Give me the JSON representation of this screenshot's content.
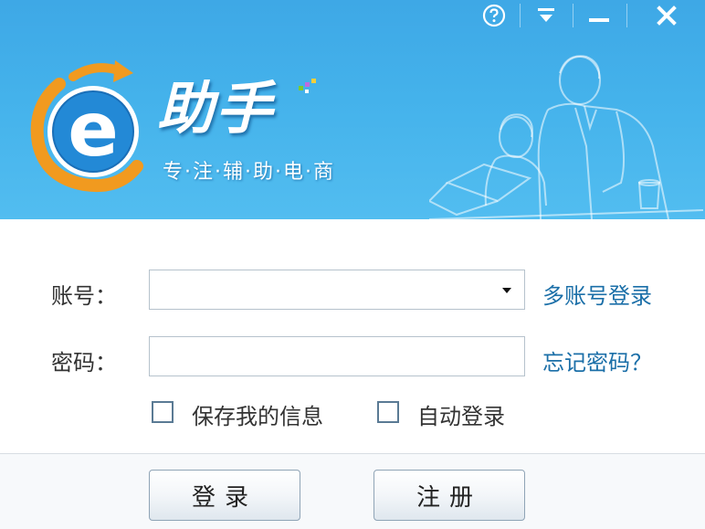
{
  "header": {
    "brand": "助手",
    "slogan": "专·注·辅·助·电·商",
    "logo_letter": "e",
    "controls": [
      "help-icon",
      "dropdown-menu-icon",
      "minimize-icon",
      "close-icon"
    ]
  },
  "form": {
    "account_label": "账号：",
    "account_value": "",
    "multi_account_link": "多账号登录",
    "password_label": "密码：",
    "password_value": "",
    "forgot_link": "忘记密码？",
    "save_info_label": "保存我的信息",
    "save_info_checked": false,
    "auto_login_label": "自动登录",
    "auto_login_checked": false
  },
  "footer": {
    "login_label": "登录",
    "register_label": "注册"
  },
  "colors": {
    "header_blue": "#44b2eb",
    "link_blue": "#1b6fa8",
    "logo_orange": "#f19a1f"
  }
}
